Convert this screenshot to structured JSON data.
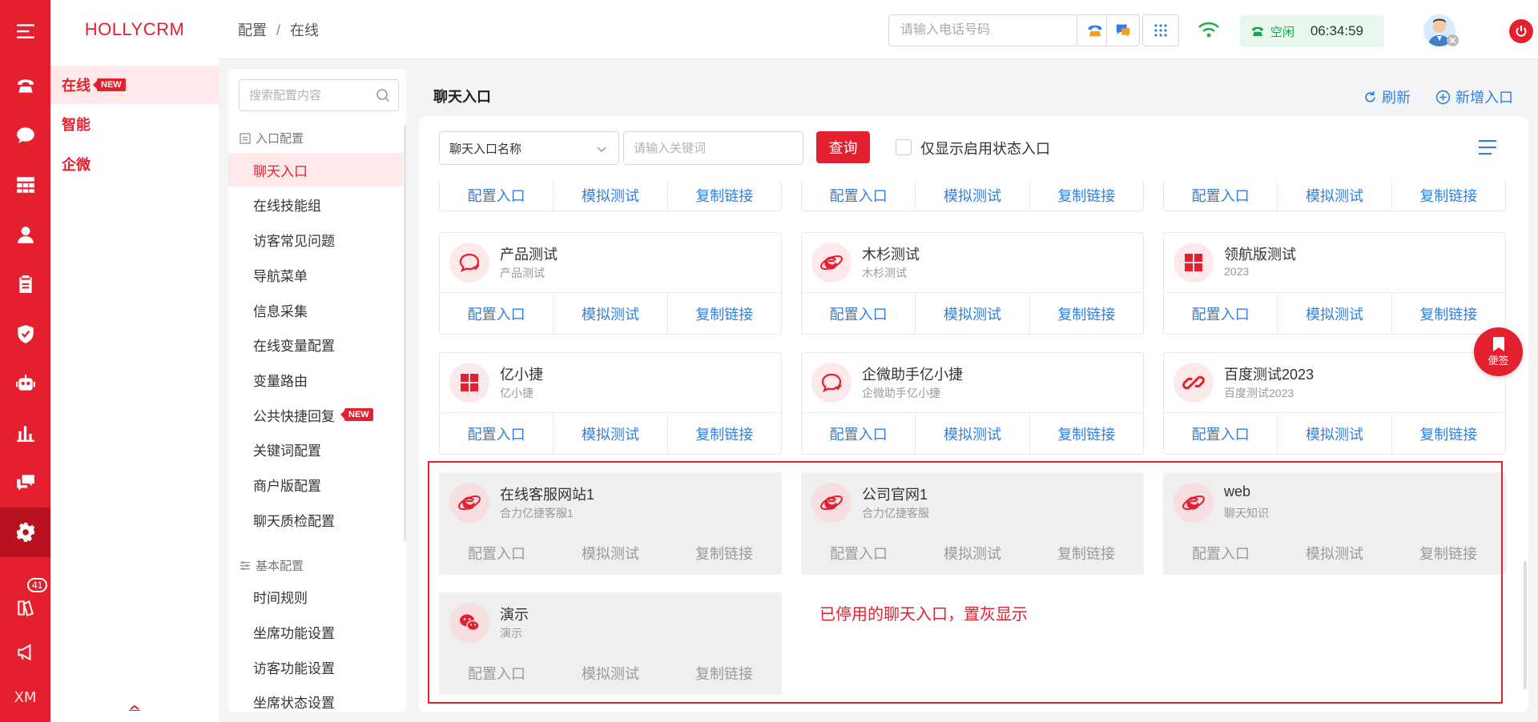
{
  "brand": "HOLLYCRM",
  "modules": [
    {
      "label": "在线",
      "badge": "NEW"
    },
    {
      "label": "智能"
    },
    {
      "label": "企微"
    }
  ],
  "rail": {
    "notification_count": "41",
    "user_initials": "XM"
  },
  "breadcrumb": {
    "parent": "配置",
    "separator": "/",
    "current": "在线"
  },
  "header": {
    "phone_placeholder": "请输入电话号码",
    "agent_status": "空闲",
    "timer": "06:34:59"
  },
  "config_nav": {
    "search_placeholder": "搜索配置内容",
    "group1": "入口配置",
    "group1_items": [
      {
        "label": "聊天入口"
      },
      {
        "label": "在线技能组"
      },
      {
        "label": "访客常见问题"
      },
      {
        "label": "导航菜单"
      },
      {
        "label": "信息采集"
      },
      {
        "label": "在线变量配置"
      },
      {
        "label": "变量路由"
      },
      {
        "label": "公共快捷回复",
        "badge": "NEW"
      },
      {
        "label": "关键词配置"
      },
      {
        "label": "商户版配置"
      },
      {
        "label": "聊天质检配置"
      }
    ],
    "group2": "基本配置",
    "group2_items": [
      {
        "label": "时间规则"
      },
      {
        "label": "坐席功能设置"
      },
      {
        "label": "访客功能设置"
      },
      {
        "label": "坐席状态设置"
      }
    ]
  },
  "main": {
    "title": "聊天入口",
    "refresh_label": "刷新",
    "add_label": "新增入口"
  },
  "filter": {
    "select_value": "聊天入口名称",
    "keyword_placeholder": "请输入关键词",
    "query_label": "查询",
    "only_enabled_label": "仅显示启用状态入口"
  },
  "card_actions": {
    "configure": "配置入口",
    "simulate": "模拟测试",
    "copy": "复制链接"
  },
  "cards": [
    {
      "name": "产品测试",
      "sub": "产品测试",
      "icon": "chat-bubble-icon",
      "disabled": false
    },
    {
      "name": "木杉测试",
      "sub": "木杉测试",
      "icon": "ie-browser-icon",
      "disabled": false
    },
    {
      "name": "领航版测试",
      "sub": "2023",
      "icon": "windows-icon",
      "disabled": false
    },
    {
      "name": "亿小捷",
      "sub": "亿小捷",
      "icon": "windows-icon",
      "disabled": false
    },
    {
      "name": "企微助手亿小捷",
      "sub": "企微助手亿小捷",
      "icon": "chat-bubble-icon",
      "disabled": false
    },
    {
      "name": "百度测试2023",
      "sub": "百度测试2023",
      "icon": "baidu-link-icon",
      "disabled": false
    },
    {
      "name": "在线客服网站1",
      "sub": "合力亿捷客服1",
      "icon": "ie-browser-icon",
      "disabled": true
    },
    {
      "name": "公司官网1",
      "sub": "合力亿捷客服",
      "icon": "ie-browser-icon",
      "disabled": true
    },
    {
      "name": "web",
      "sub": "聊天知识",
      "icon": "ie-browser-icon",
      "disabled": true
    },
    {
      "name": "演示",
      "sub": "演示",
      "icon": "wechat-icon",
      "disabled": true
    }
  ],
  "annotation": "已停用的聊天入口，置灰显示",
  "sticky_note_label": "便签",
  "colors": {
    "brand_red": "#e5202e",
    "link_blue": "#2f7fe0",
    "status_green": "#17a34a",
    "disabled_gray": "#efefef"
  }
}
